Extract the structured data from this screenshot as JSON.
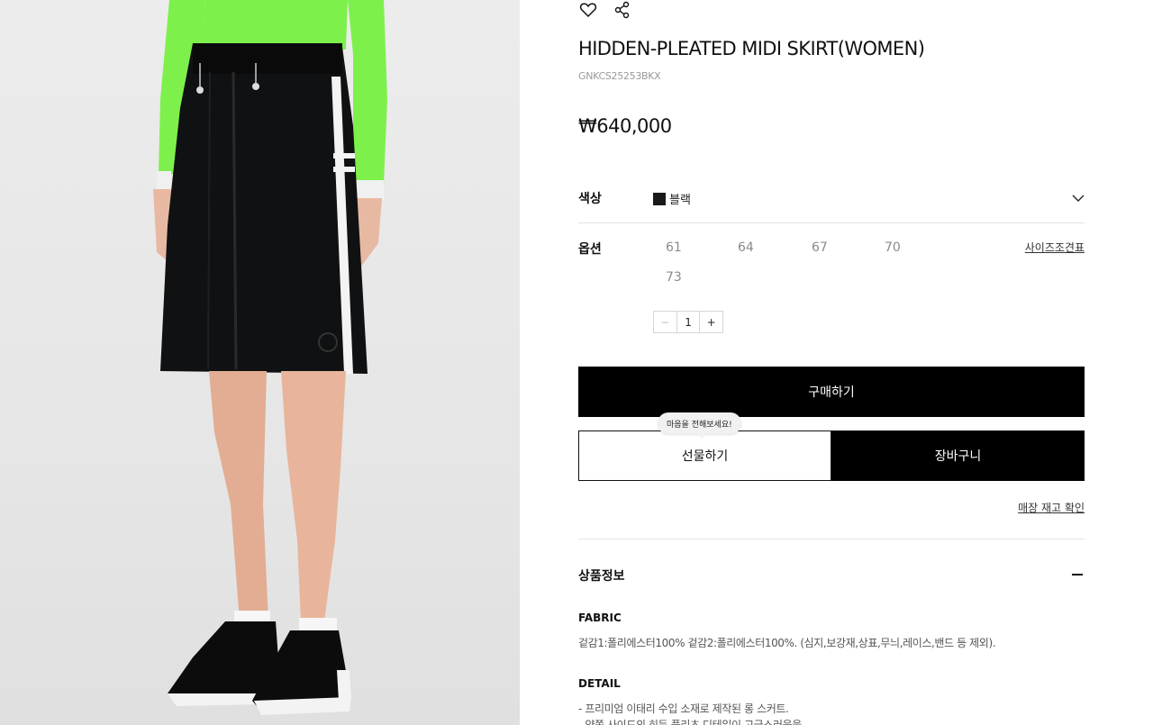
{
  "product": {
    "title": "HIDDEN-PLEATED MIDI SKIRT(WOMEN)",
    "code": "GNKCS25253BKX",
    "price": "₩640,000"
  },
  "color": {
    "label": "색상",
    "value": "블랙",
    "swatch": "#1a1a1a"
  },
  "option": {
    "label": "옵션",
    "sizes": [
      "61",
      "64",
      "67",
      "70",
      "73"
    ],
    "size_guide": "사이즈조견표"
  },
  "quantity": {
    "minus": "−",
    "value": "1",
    "plus": "+"
  },
  "buttons": {
    "buy": "구매하기",
    "gift": "선물하기",
    "cart": "장바구니",
    "gift_tooltip": "마음을 전해보세요!"
  },
  "stock_check": "매장 재고 확인",
  "info": {
    "title": "상품정보",
    "fabric_heading": "FABRIC",
    "fabric_text": "겉감1:폴리에스터100% 겉감2:폴리에스터100%. (심지,보강재,상표,무늬,레이스,밴드 등 제외).",
    "detail_heading": "DETAIL",
    "detail_line1": "- 프리미엄 이태리 수입 소재로 제작된 롱 스커트.",
    "detail_line2": "- 양쪽 사이드의 히든 플리츠 디테일이 고급스러움을"
  },
  "icons": {
    "wishlist": "heart-icon",
    "share": "share-icon",
    "color_toggle": "chevron-down-icon",
    "info_toggle": "minus-icon"
  }
}
